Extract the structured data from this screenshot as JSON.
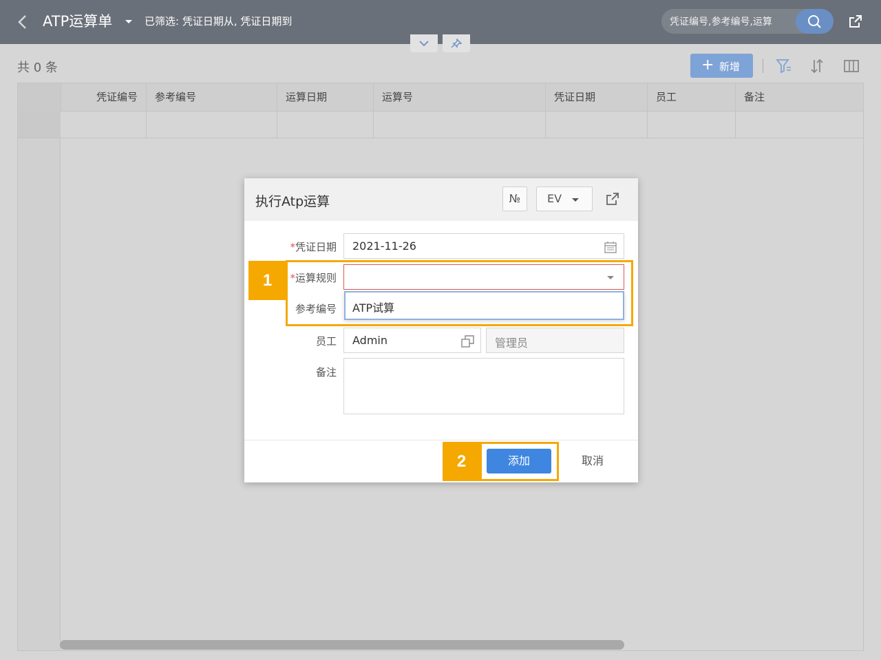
{
  "header": {
    "title": "ATP运算单",
    "filter_text": "已筛选: 凭证日期从, 凭证日期到",
    "search_placeholder": "凭证编号,参考编号,运算"
  },
  "toolbar": {
    "record_count": "共 0 条",
    "add_new_label": "新增"
  },
  "table": {
    "columns": [
      "凭证编号",
      "参考编号",
      "运算日期",
      "运算号",
      "凭证日期",
      "员工",
      "备注"
    ]
  },
  "modal": {
    "title": "执行Atp运算",
    "number_button": "№",
    "env_select": "EV",
    "fields": {
      "voucher_date": {
        "label": "凭证日期",
        "required_mark": "*",
        "value": "2021-11-26"
      },
      "calc_rule": {
        "label": "运算规则",
        "required_mark": "*",
        "value": ""
      },
      "reference_no": {
        "label": "参考编号"
      },
      "employee": {
        "label": "员工",
        "value": "Admin",
        "name": "管理员"
      },
      "remark": {
        "label": "备注",
        "value": ""
      }
    },
    "dropdown_options": [
      "ATP试算"
    ],
    "confirm_label": "添加",
    "cancel_label": "取消"
  },
  "annotations": {
    "step1": "1",
    "step2": "2",
    "color": "#f5a800"
  },
  "colors": {
    "header_bg": "#6a7079",
    "primary": "#3f86e0",
    "error": "#e25555"
  }
}
